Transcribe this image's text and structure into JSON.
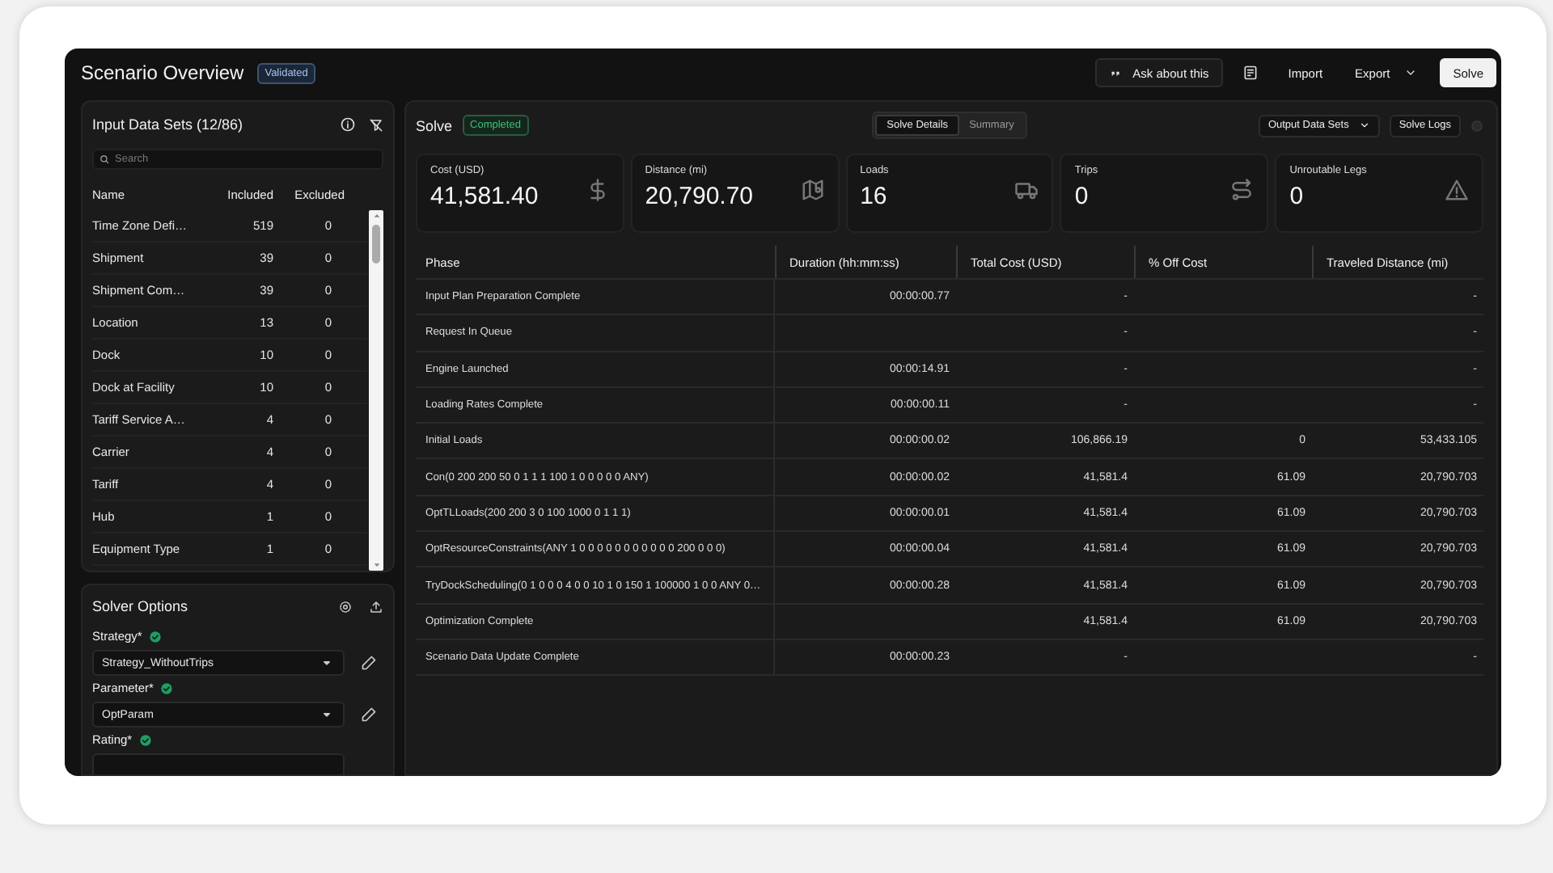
{
  "header": {
    "title": "Scenario Overview",
    "badge": "Validated",
    "ask_button": "Ask about this",
    "import_button": "Import",
    "export_button": "Export",
    "solve_button": "Solve"
  },
  "input_data_sets": {
    "title": "Input Data Sets (12/86)",
    "search": {
      "placeholder": "Search"
    },
    "columns": [
      "Name",
      "Included",
      "Excluded"
    ],
    "rows": [
      {
        "name": "Time Zone Defi…",
        "included": "519",
        "excluded": "0"
      },
      {
        "name": "Shipment",
        "included": "39",
        "excluded": "0"
      },
      {
        "name": "Shipment Com…",
        "included": "39",
        "excluded": "0"
      },
      {
        "name": "Location",
        "included": "13",
        "excluded": "0"
      },
      {
        "name": "Dock",
        "included": "10",
        "excluded": "0"
      },
      {
        "name": "Dock at Facility",
        "included": "10",
        "excluded": "0"
      },
      {
        "name": "Tariff Service A…",
        "included": "4",
        "excluded": "0"
      },
      {
        "name": "Carrier",
        "included": "4",
        "excluded": "0"
      },
      {
        "name": "Tariff",
        "included": "4",
        "excluded": "0"
      },
      {
        "name": "Hub",
        "included": "1",
        "excluded": "0"
      },
      {
        "name": "Equipment Type",
        "included": "1",
        "excluded": "0"
      }
    ]
  },
  "solver_options": {
    "title": "Solver Options",
    "fields": [
      {
        "label": "Strategy*",
        "valid": true,
        "value": "Strategy_WithoutTrips"
      },
      {
        "label": "Parameter*",
        "valid": true,
        "value": "OptParam"
      },
      {
        "label": "Rating*",
        "valid": true
      }
    ]
  },
  "solve": {
    "title": "Solve",
    "status": "Completed",
    "tabs": [
      {
        "label": "Solve Details",
        "selected": true
      },
      {
        "label": "Summary",
        "selected": false
      }
    ],
    "output_button": "Output Data Sets",
    "logs_button": "Solve Logs",
    "kpis": [
      {
        "label": "Cost (USD)",
        "value": "41,581.40",
        "kind": "dollar"
      },
      {
        "label": "Distance (mi)",
        "value": "20,790.70",
        "kind": "map"
      },
      {
        "label": "Loads",
        "value": "16",
        "kind": "truck"
      },
      {
        "label": "Trips",
        "value": "0",
        "kind": "route"
      },
      {
        "label": "Unroutable Legs",
        "value": "0",
        "kind": "warning"
      }
    ],
    "table": {
      "columns": [
        "Phase",
        "Duration (hh:mm:ss)",
        "Total Cost (USD)",
        "% Off Cost",
        "Traveled Distance (mi)"
      ],
      "rows": [
        [
          "Input Plan Preparation Complete",
          "00:00:00.77",
          "-",
          "",
          "-"
        ],
        [
          "Request In Queue",
          "",
          "-",
          "",
          "-"
        ],
        [
          "Engine Launched",
          "00:00:14.91",
          "-",
          "",
          "-"
        ],
        [
          "Loading Rates Complete",
          "00:00:00.11",
          "-",
          "",
          "-"
        ],
        [
          "Initial Loads",
          "00:00:00.02",
          "106,866.19",
          "0",
          "53,433.105"
        ],
        [
          "Con(0 200 200 50 0 1 1 1 100 1 0 0 0 0 0 ANY)",
          "00:00:00.02",
          "41,581.4",
          "61.09",
          "20,790.703"
        ],
        [
          "OptTLLoads(200 200 3 0 100 1000 0 1 1 1)",
          "00:00:00.01",
          "41,581.4",
          "61.09",
          "20,790.703"
        ],
        [
          "OptResourceConstraints(ANY 1 0 0 0 0 0 0 0 0 0 0 0 200 0 0 0)",
          "00:00:00.04",
          "41,581.4",
          "61.09",
          "20,790.703"
        ],
        [
          "TryDockScheduling(0 1 0 0 0 4 0 0 10 1 0 150 1 100000 1 0 0 ANY 0…",
          "00:00:00.28",
          "41,581.4",
          "61.09",
          "20,790.703"
        ],
        [
          "Optimization Complete",
          "",
          "41,581.4",
          "61.09",
          "20,790.703"
        ],
        [
          "Scenario Data Update Complete",
          "00:00:00.23",
          "-",
          "",
          "-"
        ]
      ]
    }
  }
}
